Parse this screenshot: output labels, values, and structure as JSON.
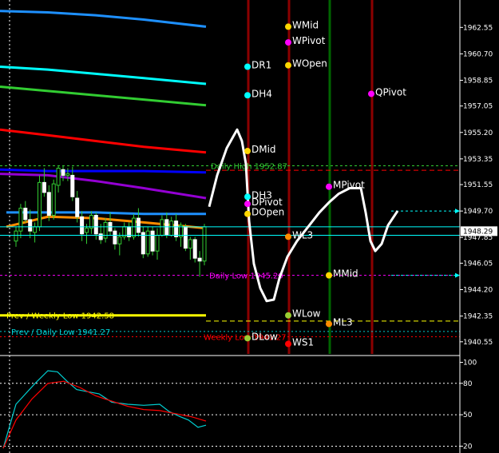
{
  "chart_data": [
    {
      "type": "candlestick",
      "ylim": [
        1939.7,
        1964.3
      ],
      "y_ticks": [
        "1962.55",
        "1960.70",
        "1958.85",
        "1957.05",
        "1955.20",
        "1953.35",
        "1951.55",
        "1949.70",
        "1947.85",
        "1946.05",
        "1944.20",
        "1942.35",
        "1940.55"
      ],
      "current_price": "1948.29",
      "current_price_value": 1948.29,
      "levels": [
        {
          "name": "Daily High",
          "label": "Daily High 1952.87",
          "value": 1952.87,
          "color": "#32cd32"
        },
        {
          "name": "Daily Low",
          "label": "Daily Low 1945.20",
          "value": 1945.2,
          "color": "#ff00ff"
        },
        {
          "name": "Prev / Weekly Low",
          "label": "Prev / Weekly Low 1942.58",
          "value": 1942.4,
          "color": "#ffff00"
        },
        {
          "name": "Prev / Daily Low",
          "label": "Prev / Daily Low 1941.27",
          "value": 1941.27,
          "color": "#00ced1"
        },
        {
          "name": "Weekly Low",
          "label": "Weekly Low 1941.27",
          "value": 1940.9,
          "color": "#ff0000"
        }
      ],
      "pivots": [
        {
          "label": "WMid",
          "x_session": "W",
          "value": 1962.6,
          "color": "#ffd700"
        },
        {
          "label": "WPivot",
          "x_session": "W",
          "value": 1961.5,
          "color": "#ff00ff"
        },
        {
          "label": "WOpen",
          "x_session": "W",
          "value": 1959.9,
          "color": "#ffd700"
        },
        {
          "label": "DR1",
          "x_session": "D",
          "value": 1959.8,
          "color": "#00ffff"
        },
        {
          "label": "DH4",
          "x_session": "D",
          "value": 1957.8,
          "color": "#00ffff"
        },
        {
          "label": "QPivot",
          "x_session": "Q",
          "value": 1957.9,
          "color": "#ff00ff"
        },
        {
          "label": "DMid",
          "x_session": "D",
          "value": 1953.9,
          "color": "#ffd700"
        },
        {
          "label": "MPivot",
          "x_session": "M",
          "value": 1951.4,
          "color": "#ff00ff"
        },
        {
          "label": "DH3",
          "x_session": "D",
          "value": 1950.7,
          "color": "#00ffff"
        },
        {
          "label": "DPivot",
          "x_session": "D",
          "value": 1950.2,
          "color": "#ff00ff"
        },
        {
          "label": "DOpen",
          "x_session": "D",
          "value": 1949.5,
          "color": "#ffd700"
        },
        {
          "label": "WL3",
          "x_session": "W",
          "value": 1947.9,
          "color": "#ff8c00"
        },
        {
          "label": "MMid",
          "x_session": "M",
          "value": 1945.2,
          "color": "#ffd700"
        },
        {
          "label": "WLow",
          "x_session": "W",
          "value": 1942.4,
          "color": "#9acd32"
        },
        {
          "label": "ML3",
          "x_session": "M",
          "value": 1941.8,
          "color": "#ff8c00"
        },
        {
          "label": "DLow",
          "x_session": "D",
          "value": 1940.8,
          "color": "#9acd32"
        },
        {
          "label": "WS1",
          "x_session": "W",
          "value": 1940.4,
          "color": "#ff0000"
        }
      ],
      "candles": [
        [
          1947.6,
          1948.6,
          1947.2,
          1948.3
        ],
        [
          1948.3,
          1950.2,
          1947.8,
          1949.9
        ],
        [
          1949.9,
          1950.4,
          1948.9,
          1949.1
        ],
        [
          1949.1,
          1949.8,
          1947.8,
          1948.3
        ],
        [
          1948.2,
          1948.9,
          1947.5,
          1948.6
        ],
        [
          1948.6,
          1952.2,
          1948.3,
          1951.7
        ],
        [
          1951.7,
          1952.7,
          1950.7,
          1951.0
        ],
        [
          1951.0,
          1951.5,
          1949.0,
          1949.4
        ],
        [
          1949.4,
          1951.9,
          1949.1,
          1951.6
        ],
        [
          1951.5,
          1952.9,
          1951.0,
          1952.7
        ],
        [
          1952.6,
          1952.9,
          1951.8,
          1952.2
        ],
        [
          1952.2,
          1952.7,
          1951.8,
          1952.3
        ],
        [
          1952.2,
          1952.8,
          1950.4,
          1950.7
        ],
        [
          1950.6,
          1951.1,
          1948.9,
          1949.3
        ],
        [
          1949.3,
          1949.7,
          1947.6,
          1948.1
        ],
        [
          1948.2,
          1948.8,
          1947.4,
          1948.5
        ],
        [
          1948.5,
          1949.7,
          1948.1,
          1949.4
        ],
        [
          1949.4,
          1949.6,
          1947.7,
          1948.1
        ],
        [
          1948.1,
          1948.8,
          1947.4,
          1947.7
        ],
        [
          1947.8,
          1949.2,
          1947.5,
          1948.9
        ],
        [
          1948.9,
          1949.6,
          1948.0,
          1948.3
        ],
        [
          1948.3,
          1948.5,
          1947.0,
          1947.4
        ],
        [
          1947.4,
          1948.2,
          1946.6,
          1947.9
        ],
        [
          1947.9,
          1948.9,
          1947.7,
          1948.6
        ],
        [
          1948.6,
          1948.9,
          1947.6,
          1947.9
        ],
        [
          1947.9,
          1949.5,
          1947.7,
          1949.2
        ],
        [
          1949.2,
          1949.9,
          1947.9,
          1948.2
        ],
        [
          1948.2,
          1948.6,
          1946.4,
          1946.7
        ],
        [
          1946.7,
          1948.6,
          1946.5,
          1948.3
        ],
        [
          1948.3,
          1948.6,
          1946.6,
          1946.9
        ],
        [
          1946.9,
          1948.5,
          1946.3,
          1948.0
        ],
        [
          1948.0,
          1949.4,
          1947.9,
          1949.1
        ],
        [
          1949.1,
          1949.6,
          1947.8,
          1948.0
        ],
        [
          1948.0,
          1949.3,
          1947.9,
          1949.0
        ],
        [
          1949.0,
          1949.5,
          1947.6,
          1947.9
        ],
        [
          1947.9,
          1948.9,
          1947.2,
          1948.7
        ],
        [
          1948.6,
          1948.8,
          1946.9,
          1947.1
        ],
        [
          1947.1,
          1947.9,
          1946.3,
          1947.7
        ],
        [
          1947.7,
          1947.9,
          1946.1,
          1946.4
        ],
        [
          1946.4,
          1946.9,
          1945.1,
          1946.2
        ],
        [
          1946.2,
          1948.8,
          1945.9,
          1948.6
        ]
      ],
      "moving_averages": [
        {
          "color": "#1e90ff",
          "points": [
            [
              0,
              1963.7
            ],
            [
              60,
              1963.6
            ],
            [
              120,
              1963.4
            ],
            [
              180,
              1963.1
            ],
            [
              258,
              1962.6
            ]
          ]
        },
        {
          "color": "#00ffff",
          "points": [
            [
              0,
              1959.8
            ],
            [
              60,
              1959.6
            ],
            [
              120,
              1959.3
            ],
            [
              180,
              1959.0
            ],
            [
              258,
              1958.6
            ]
          ]
        },
        {
          "color": "#32cd32",
          "points": [
            [
              0,
              1958.4
            ],
            [
              60,
              1958.1
            ],
            [
              120,
              1957.8
            ],
            [
              180,
              1957.5
            ],
            [
              258,
              1957.1
            ]
          ]
        },
        {
          "color": "#ff0000",
          "points": [
            [
              0,
              1955.4
            ],
            [
              60,
              1955.0
            ],
            [
              120,
              1954.6
            ],
            [
              180,
              1954.2
            ],
            [
              258,
              1953.8
            ]
          ]
        },
        {
          "color": "#0000ff",
          "points": [
            [
              0,
              1952.6
            ],
            [
              60,
              1952.5
            ],
            [
              120,
              1952.5
            ],
            [
              180,
              1952.5
            ],
            [
              258,
              1952.4
            ]
          ]
        },
        {
          "color": "#9400d3",
          "points": [
            [
              0,
              1952.3
            ],
            [
              60,
              1952.2
            ],
            [
              120,
              1951.8
            ],
            [
              180,
              1951.3
            ],
            [
              258,
              1950.6
            ]
          ]
        },
        {
          "color": "#1e90ff",
          "points": [
            [
              8,
              1949.6
            ],
            [
              60,
              1949.6
            ],
            [
              120,
              1949.6
            ],
            [
              180,
              1949.5
            ],
            [
              258,
              1949.5
            ]
          ]
        },
        {
          "color": "#ff8c00",
          "points": [
            [
              8,
              1948.6
            ],
            [
              60,
              1949.3
            ],
            [
              120,
              1949.2
            ],
            [
              180,
              1948.9
            ],
            [
              258,
              1948.5
            ]
          ]
        }
      ],
      "projection": [
        [
          262,
          1950.0
        ],
        [
          272,
          1952.2
        ],
        [
          284,
          1954.1
        ],
        [
          297,
          1955.4
        ],
        [
          303,
          1954.6
        ],
        [
          308,
          1953.0
        ],
        [
          312,
          1949.0
        ],
        [
          318,
          1946.0
        ],
        [
          326,
          1944.3
        ],
        [
          334,
          1943.4
        ],
        [
          343,
          1943.5
        ],
        [
          350,
          1945.0
        ],
        [
          360,
          1946.5
        ],
        [
          372,
          1947.6
        ],
        [
          386,
          1948.6
        ],
        [
          400,
          1949.6
        ],
        [
          412,
          1950.3
        ],
        [
          424,
          1950.9
        ],
        [
          438,
          1951.3
        ],
        [
          452,
          1951.3
        ],
        [
          458,
          1949.6
        ],
        [
          464,
          1947.6
        ],
        [
          470,
          1946.9
        ],
        [
          478,
          1947.4
        ],
        [
          486,
          1948.7
        ],
        [
          498,
          1949.7
        ]
      ]
    },
    {
      "type": "line",
      "ylim": [
        15,
        105
      ],
      "y_ticks": [
        "100",
        "80",
        "50",
        "20"
      ],
      "series": [
        {
          "color": "#00ced1",
          "points": [
            [
              4,
              18
            ],
            [
              20,
              60
            ],
            [
              44,
              80
            ],
            [
              60,
              92
            ],
            [
              72,
              91
            ],
            [
              84,
              82
            ],
            [
              96,
              74
            ],
            [
              110,
              72
            ],
            [
              124,
              70
            ],
            [
              140,
              62
            ],
            [
              160,
              60
            ],
            [
              180,
              59
            ],
            [
              200,
              60
            ],
            [
              212,
              53
            ],
            [
              226,
              48
            ],
            [
              236,
              45
            ],
            [
              248,
              38
            ],
            [
              258,
              40
            ]
          ]
        },
        {
          "color": "#ff0000",
          "points": [
            [
              4,
              18
            ],
            [
              20,
              45
            ],
            [
              40,
              65
            ],
            [
              60,
              80
            ],
            [
              80,
              82
            ],
            [
              100,
              76
            ],
            [
              120,
              68
            ],
            [
              140,
              63
            ],
            [
              160,
              58
            ],
            [
              180,
              55
            ],
            [
              200,
              54
            ],
            [
              220,
              51
            ],
            [
              240,
              48
            ],
            [
              258,
              44
            ]
          ]
        }
      ]
    }
  ]
}
